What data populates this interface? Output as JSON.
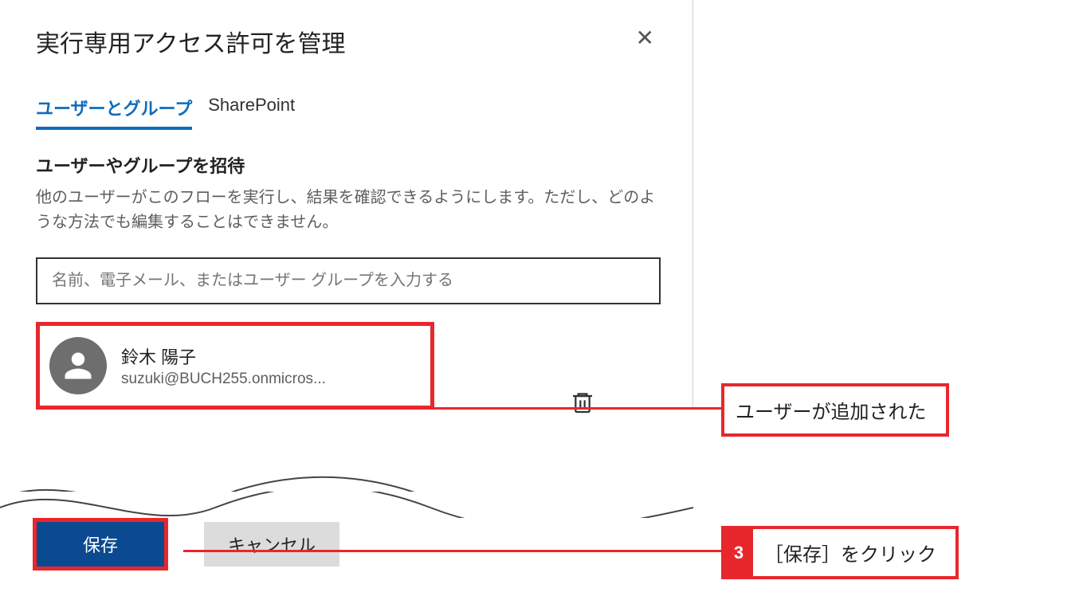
{
  "dialog": {
    "title": "実行専用アクセス許可を管理",
    "tabs": {
      "users": "ユーザーとグループ",
      "sharepoint": "SharePoint"
    },
    "invite": {
      "heading": "ユーザーやグループを招待",
      "desc": "他のユーザーがこのフローを実行し、結果を確認できるようにします。ただし、どのような方法でも編集することはできません。",
      "placeholder": "名前、電子メール、またはユーザー グループを入力する"
    },
    "user": {
      "name": "鈴木 陽子",
      "email": "suzuki@BUCH255.onmicros..."
    },
    "footer": {
      "save": "保存",
      "cancel": "キャンセル"
    }
  },
  "callouts": {
    "added": "ユーザーが追加された",
    "save_num": "3",
    "save_text": "［保存］をクリック"
  }
}
